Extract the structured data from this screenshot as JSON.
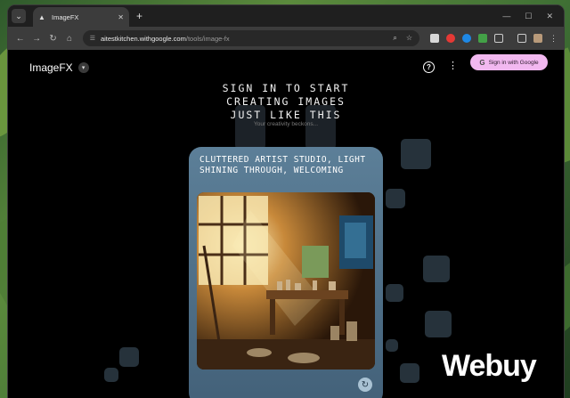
{
  "browser": {
    "tab_title": "ImageFX",
    "url_host": "aitestkitchen.withgoogle.com",
    "url_path": "/tools/image-fx"
  },
  "header": {
    "brand": "ImageFX",
    "signin_label": "Sign in with Google"
  },
  "hero": {
    "line1": "SIGN IN TO START",
    "line2": "CREATING IMAGES",
    "line3": "JUST LIKE THIS",
    "tagline": "Your creativity beckons..."
  },
  "card": {
    "title": "CLUTTERED ARTIST STUDIO, LIGHT SHINING THROUGH, WELCOMING"
  },
  "watermark": "Webuy",
  "colors": {
    "signin_bg": "#f2b8f0",
    "card_bg": "#5c7f98",
    "page_bg": "#000000"
  }
}
